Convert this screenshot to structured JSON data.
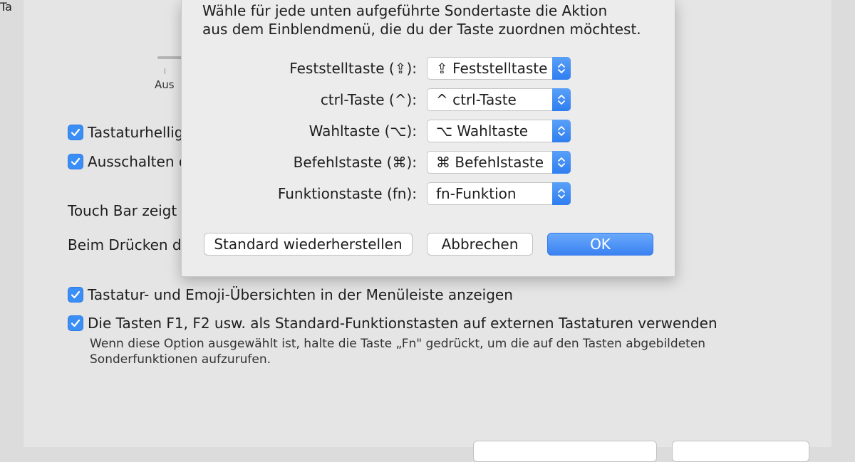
{
  "background": {
    "slider_label": "Aus",
    "partial_heading": "Ta",
    "checkbox_rows": [
      {
        "label": "Tastaturhellig",
        "checked": true
      },
      {
        "label": "Ausschalten d",
        "checked": true
      }
    ],
    "touch_bar_label": "Touch Bar zeigt",
    "press_label": "Beim Drücken de",
    "options": [
      {
        "label": "Tastatur- und Emoji-Übersichten in der Menüleiste anzeigen",
        "checked": true
      },
      {
        "label": "Die Tasten F1, F2 usw. als Standard-Funktionstasten auf externen Tastaturen verwenden",
        "checked": true
      }
    ],
    "fn_description": "Wenn diese Option ausgewählt ist, halte die Taste „Fn\" gedrückt, um die auf den Tasten abgebildeten Sonderfunktionen aufzurufen."
  },
  "sheet": {
    "intro_line1": "Wähle für jede unten aufgeführte Sondertaste die Aktion",
    "intro_line2": "aus dem Einblendmenü, die du der Taste zuordnen möchtest.",
    "keys": [
      {
        "label": "Feststelltaste (⇪):",
        "value": "⇪ Feststelltaste"
      },
      {
        "label": "ctrl-Taste (^):",
        "value": "^ ctrl-Taste"
      },
      {
        "label": "Wahltaste (⌥):",
        "value": "⌥ Wahltaste"
      },
      {
        "label": "Befehlstaste (⌘):",
        "value": "⌘ Befehlstaste"
      },
      {
        "label": "Funktionstaste (fn):",
        "value": "fn-Funktion"
      }
    ],
    "buttons": {
      "restore": "Standard wiederherstellen",
      "cancel": "Abbrechen",
      "ok": "OK"
    }
  },
  "colors": {
    "accent": "#3a8ef6",
    "sheet_bg": "#ececec",
    "pane_bg": "#e5e5e5"
  }
}
